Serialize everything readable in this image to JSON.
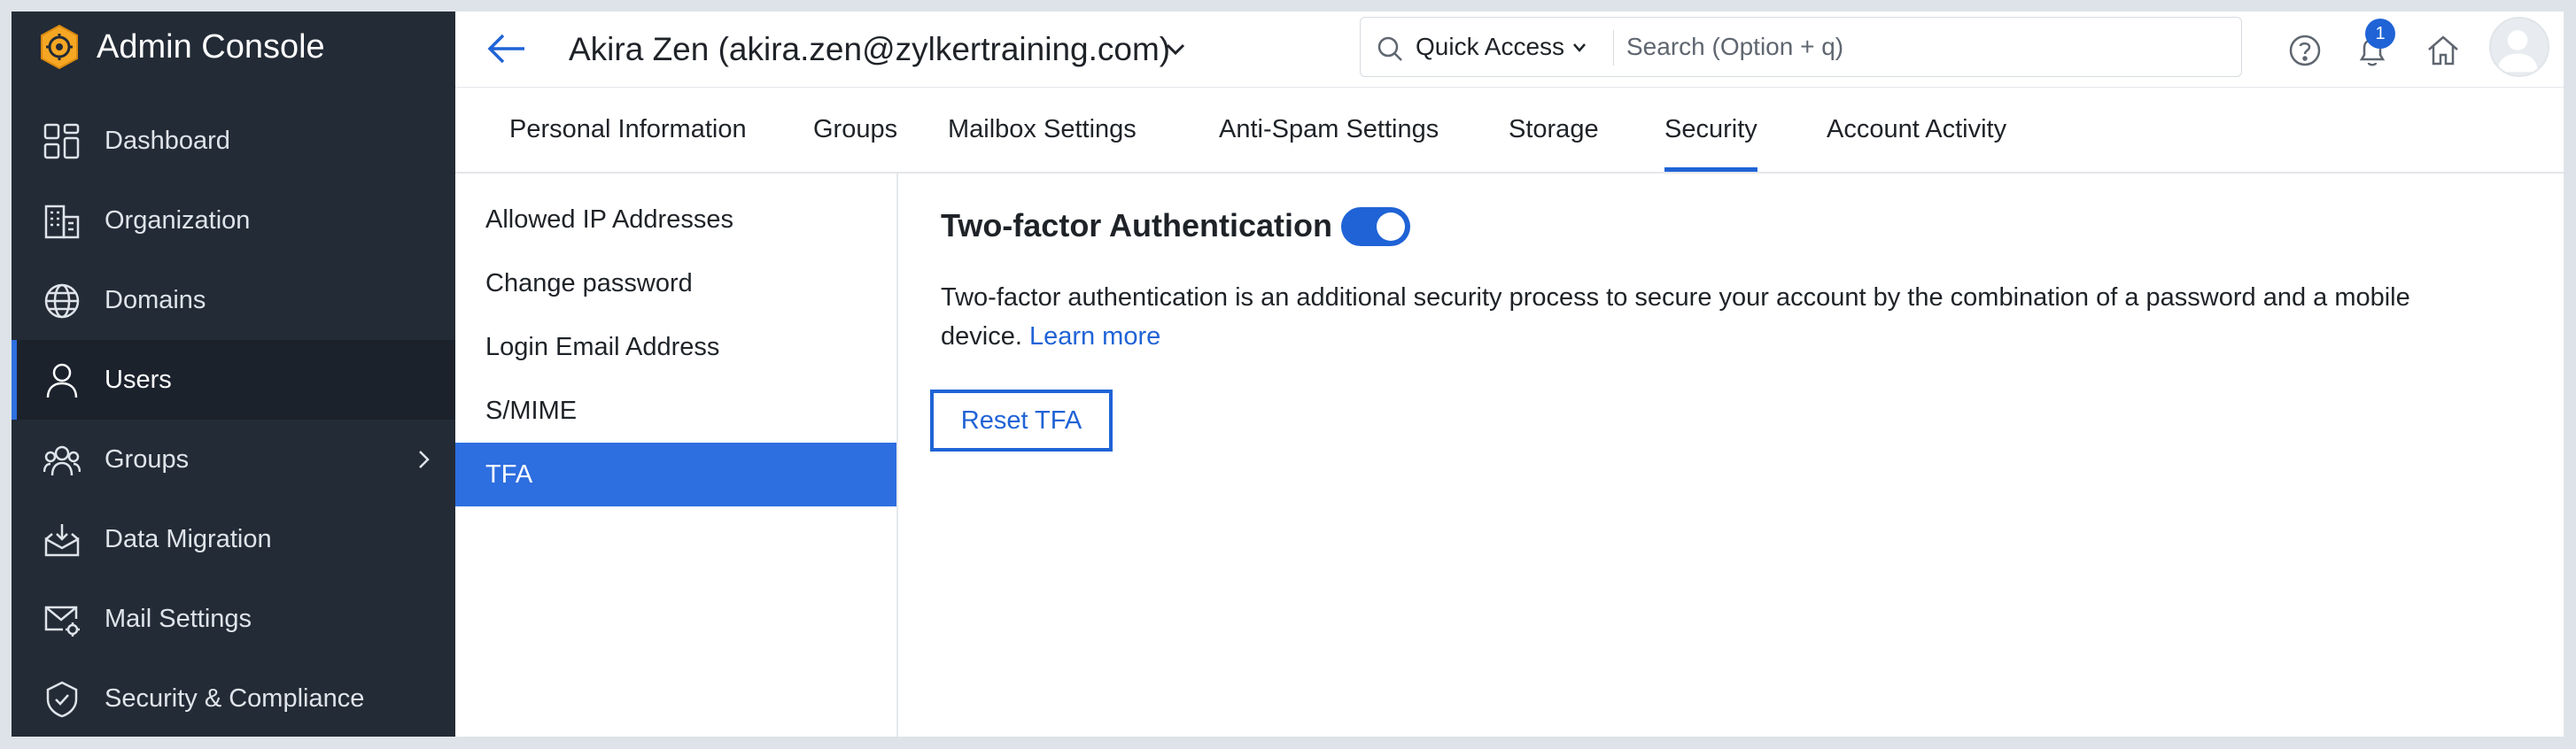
{
  "app": {
    "title": "Admin Console"
  },
  "sidebar": {
    "items": [
      {
        "label": "Dashboard",
        "icon": "dashboard-icon"
      },
      {
        "label": "Organization",
        "icon": "building-icon"
      },
      {
        "label": "Domains",
        "icon": "globe-icon"
      },
      {
        "label": "Users",
        "icon": "user-icon",
        "active": true
      },
      {
        "label": "Groups",
        "icon": "group-icon",
        "has_submenu": true
      },
      {
        "label": "Data Migration",
        "icon": "inbox-download-icon"
      },
      {
        "label": "Mail Settings",
        "icon": "mail-settings-icon"
      },
      {
        "label": "Security & Compliance",
        "icon": "shield-check-icon"
      }
    ]
  },
  "header": {
    "user_title": "Akira Zen (akira.zen@zylkertraining.com)",
    "quick_access_label": "Quick Access",
    "search_placeholder": "Search (Option + q)",
    "notification_count": "1"
  },
  "tabs": [
    {
      "label": "Personal Information"
    },
    {
      "label": "Groups"
    },
    {
      "label": "Mailbox Settings"
    },
    {
      "label": "Anti-Spam Settings"
    },
    {
      "label": "Storage"
    },
    {
      "label": "Security",
      "active": true
    },
    {
      "label": "Account Activity"
    }
  ],
  "submenu": {
    "items": [
      {
        "label": "Allowed IP Addresses"
      },
      {
        "label": "Change password"
      },
      {
        "label": "Login Email Address"
      },
      {
        "label": "S/MIME"
      },
      {
        "label": "TFA",
        "active": true
      }
    ]
  },
  "content": {
    "title": "Two-factor Authentication",
    "toggle_enabled": true,
    "description": "Two-factor authentication is an additional security process to secure your account by the combination of a password and a mobile device.",
    "learn_more": "Learn more",
    "reset_button": "Reset TFA"
  },
  "colors": {
    "sidebar_bg": "#232b36",
    "accent": "#1f63d6",
    "active_submenu": "#2d6ee0",
    "logo_orange": "#f5a623"
  }
}
